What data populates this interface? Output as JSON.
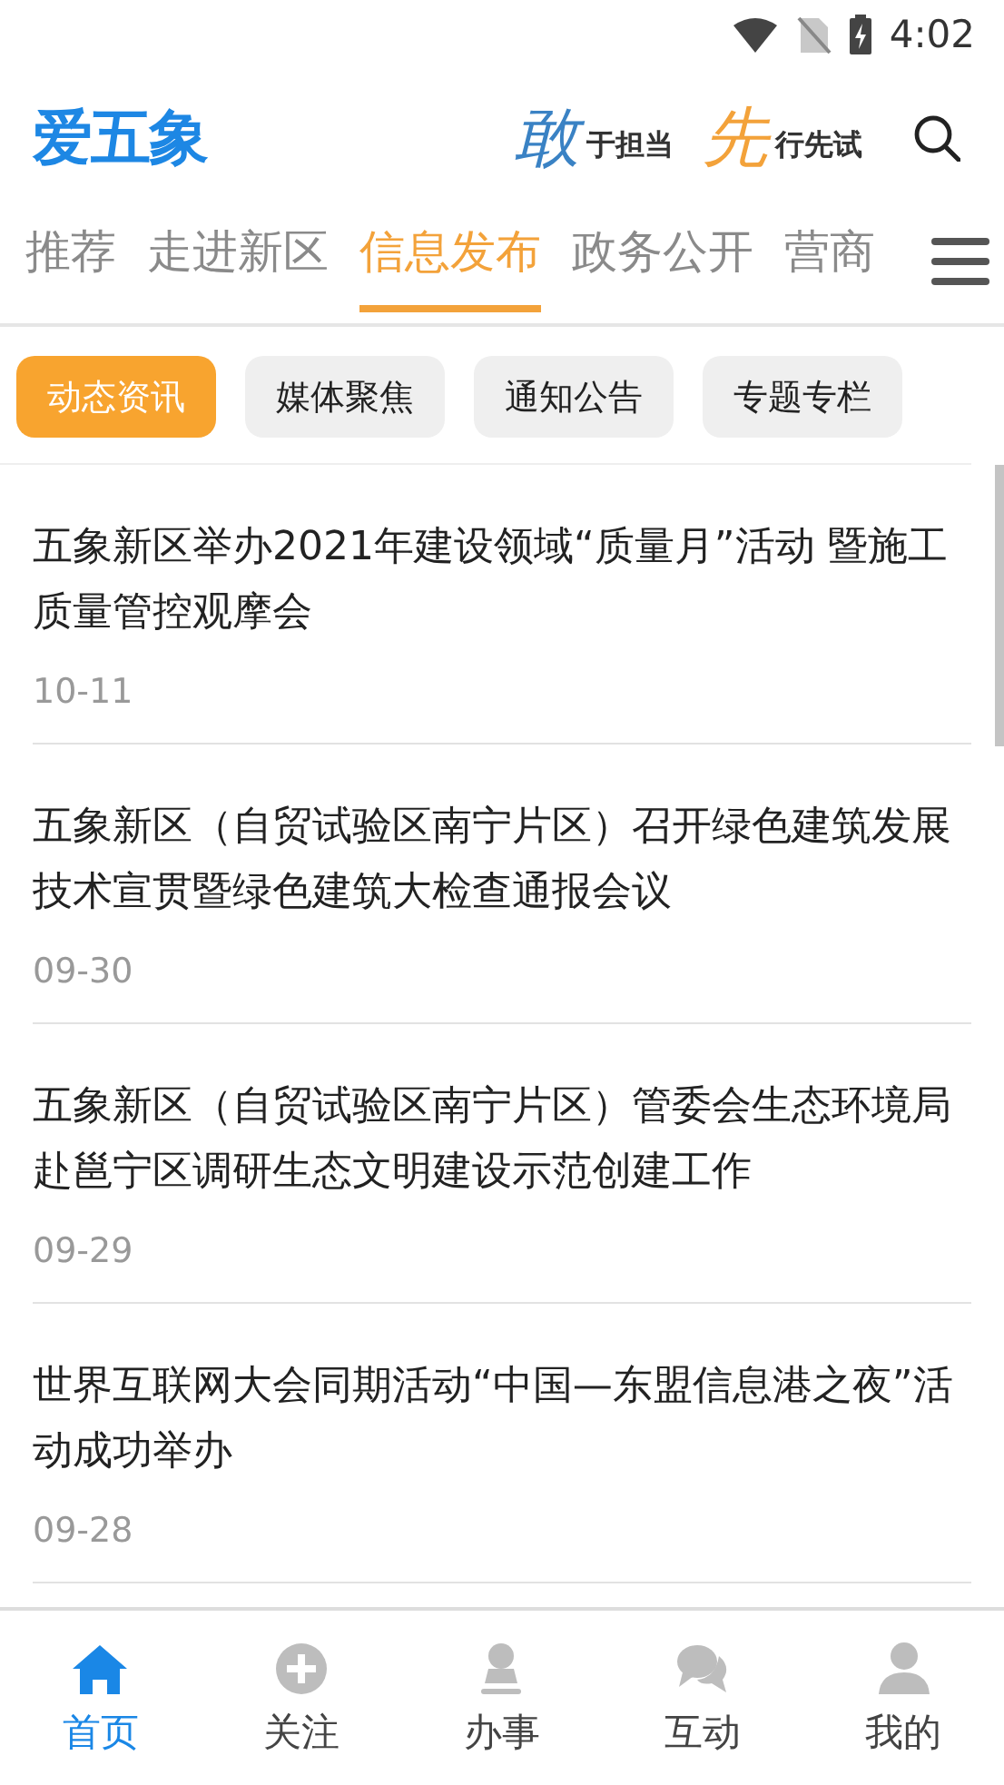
{
  "status_bar": {
    "time": "4:02"
  },
  "header": {
    "logo": "爱五象",
    "slogan": [
      {
        "text": "敢",
        "kind": "accent",
        "color": "#3a82c4"
      },
      {
        "text": "于担当",
        "kind": "plain"
      },
      {
        "text": "先",
        "kind": "accent",
        "color": "#f3a23a"
      },
      {
        "text": "行先试",
        "kind": "plain"
      }
    ]
  },
  "tabs": [
    {
      "label": "推荐",
      "selected": false
    },
    {
      "label": "走进新区",
      "selected": false
    },
    {
      "label": "信息发布",
      "selected": true
    },
    {
      "label": "政务公开",
      "selected": false
    },
    {
      "label": "营商",
      "selected": false
    }
  ],
  "chips": [
    {
      "label": "动态资讯",
      "selected": true
    },
    {
      "label": "媒体聚焦",
      "selected": false
    },
    {
      "label": "通知公告",
      "selected": false
    },
    {
      "label": "专题专栏",
      "selected": false
    }
  ],
  "articles": [
    {
      "title": "五象新区举办2021年建设领域“质量月”活动 暨施工质量管控观摩会",
      "date": "10-11"
    },
    {
      "title": "五象新区（自贸试验区南宁片区）召开绿色建筑发展技术宣贯暨绿色建筑大检查通报会议",
      "date": "09-30"
    },
    {
      "title": "五象新区（自贸试验区南宁片区）管委会生态环境局赴邕宁区调研生态文明建设示范创建工作",
      "date": "09-29"
    },
    {
      "title": "世界互联网大会同期活动“中国—东盟信息港之夜”活动成功举办",
      "date": "09-28"
    }
  ],
  "bottom_nav": [
    {
      "label": "首页",
      "selected": true
    },
    {
      "label": "关注",
      "selected": false
    },
    {
      "label": "办事",
      "selected": false
    },
    {
      "label": "互动",
      "selected": false
    },
    {
      "label": "我的",
      "selected": false
    }
  ]
}
